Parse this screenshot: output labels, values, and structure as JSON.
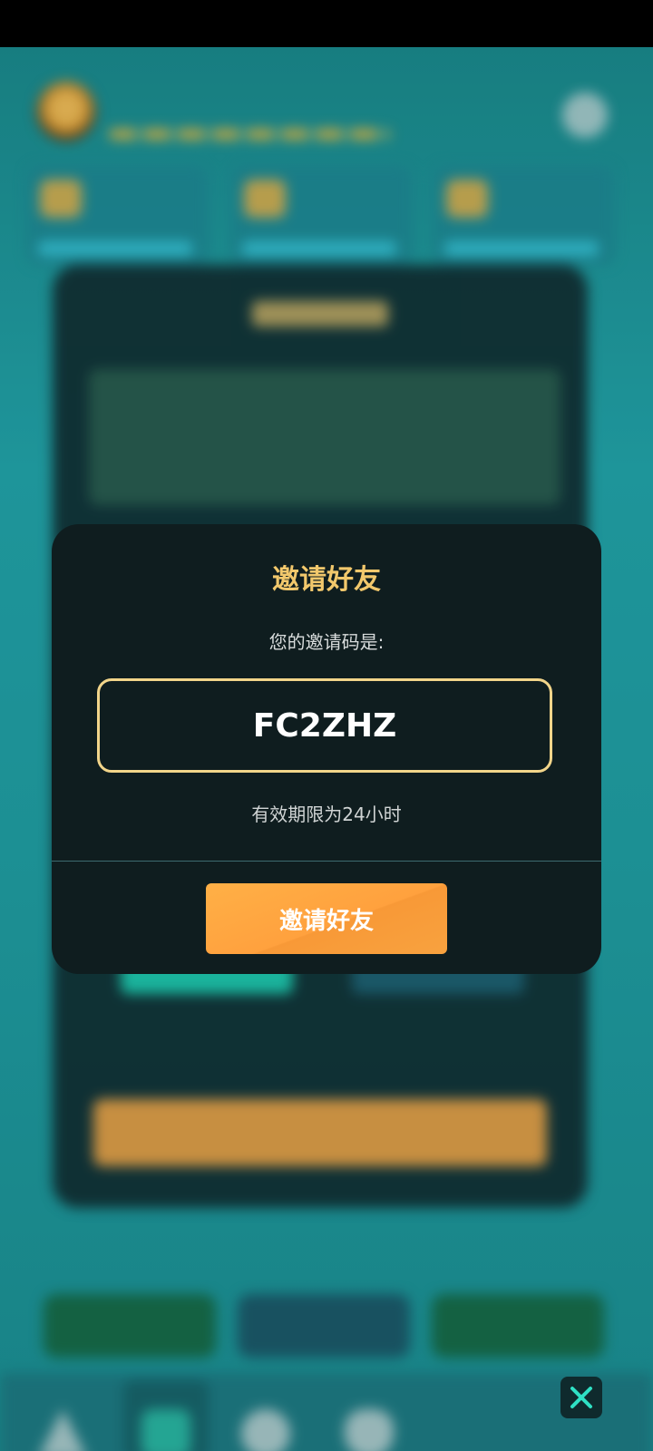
{
  "modal": {
    "title": "邀请好友",
    "code_label": "您的邀请码是:",
    "invite_code": "FC2ZHZ",
    "validity_text": "有效期限为24小时",
    "invite_button": "邀请好友"
  },
  "icons": {
    "close": "close-icon"
  },
  "colors": {
    "accent_gold": "#f2c86c",
    "button_orange": "#ffa13e",
    "modal_bg": "#0f1d1f"
  }
}
